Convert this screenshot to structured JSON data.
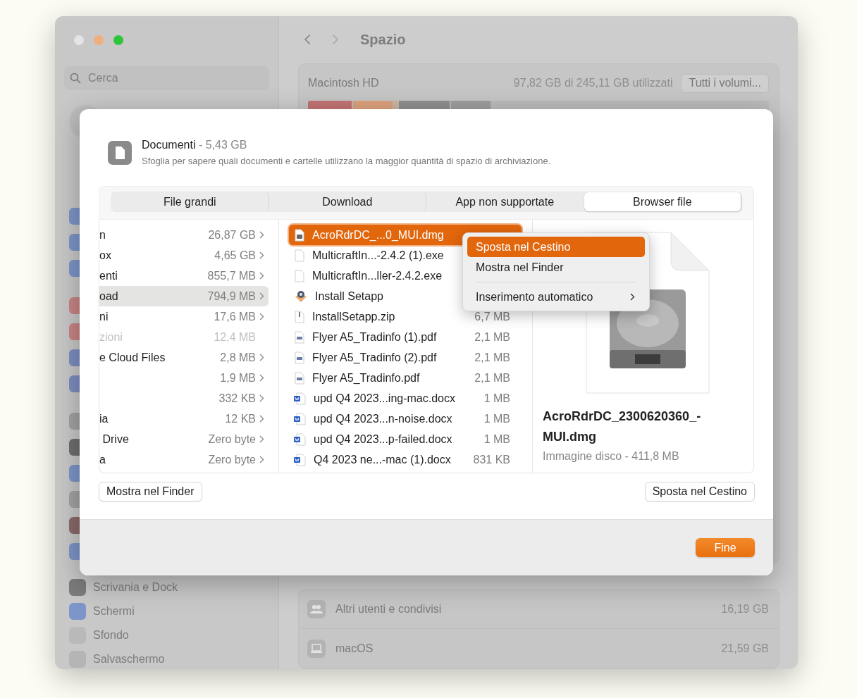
{
  "sidebar": {
    "search": {
      "placeholder": "Cerca"
    },
    "items": [
      {
        "label": "Scrivania e Dock",
        "kind": "dock"
      },
      {
        "label": "Schermi",
        "kind": "display"
      },
      {
        "label": "Sfondo",
        "kind": "wallpaper"
      },
      {
        "label": "Salvaschermo",
        "kind": "screensaver"
      }
    ]
  },
  "toolbar": {
    "title": "Spazio"
  },
  "volume": {
    "name": "Macintosh HD",
    "usage": "97,82 GB di 245,11 GB utilizzati",
    "button": "Tutti i volumi..."
  },
  "categories": [
    {
      "label": "Altri utenti e condivisi",
      "size": "16,19 GB",
      "kind": "users"
    },
    {
      "label": "macOS",
      "size": "21,59 GB",
      "kind": "laptop"
    }
  ],
  "dialog": {
    "title": "Documenti",
    "size": "- 5,43 GB",
    "description": "Sfoglia per sapere quali documenti e cartelle utilizzano la maggior quantità di spazio di archiviazione.",
    "tabs": [
      {
        "label": "File grandi",
        "selected": false
      },
      {
        "label": "Download",
        "selected": false
      },
      {
        "label": "App non supportate",
        "selected": false
      },
      {
        "label": "Browser file",
        "selected": true
      }
    ],
    "folders": [
      {
        "name": "n",
        "size": "26,87 GB",
        "selected": false,
        "disabled": false
      },
      {
        "name": "ox",
        "size": "4,65 GB",
        "selected": false,
        "disabled": false
      },
      {
        "name": "enti",
        "size": "855,7 MB",
        "selected": false,
        "disabled": false
      },
      {
        "name": "oad",
        "size": "794,9 MB",
        "selected": true,
        "disabled": false
      },
      {
        "name": "ni",
        "size": "17,6 MB",
        "selected": false,
        "disabled": false
      },
      {
        "name": "zioni",
        "size": "12,4 MB",
        "selected": false,
        "disabled": true
      },
      {
        "name": "e Cloud Files",
        "size": "2,8 MB",
        "selected": false,
        "disabled": false
      },
      {
        "size": "1,9 MB",
        "selected": false,
        "disabled": false
      },
      {
        "size": "332 KB",
        "selected": false,
        "disabled": false
      },
      {
        "name": "ia",
        "size": "12 KB",
        "selected": false,
        "disabled": false
      },
      {
        "name": " Drive",
        "size": "Zero byte",
        "selected": false,
        "disabled": false
      },
      {
        "name": "a",
        "size": "Zero byte",
        "selected": false,
        "disabled": false
      }
    ],
    "files": [
      {
        "name": "AcroRdrDC_...0_MUI.dmg",
        "kind": "dmg",
        "selected": true
      },
      {
        "name": "MulticraftIn...-2.4.2 (1).exe",
        "kind": "exe",
        "selected": false
      },
      {
        "name": "MulticraftIn...ller-2.4.2.exe",
        "kind": "exe",
        "selected": false
      },
      {
        "name": "Install Setapp",
        "kind": "app",
        "selected": false
      },
      {
        "name": "InstallSetapp.zip",
        "size": "6,7 MB",
        "kind": "zip",
        "selected": false
      },
      {
        "name": "Flyer A5_Tradinfo (1).pdf",
        "size": "2,1 MB",
        "kind": "pdf",
        "selected": false
      },
      {
        "name": "Flyer A5_Tradinfo (2).pdf",
        "size": "2,1 MB",
        "kind": "pdf",
        "selected": false
      },
      {
        "name": "Flyer A5_Tradinfo.pdf",
        "size": "2,1 MB",
        "kind": "pdf",
        "selected": false
      },
      {
        "name": "upd Q4 2023...ing-mac.docx",
        "size": "1 MB",
        "kind": "docx",
        "selected": false
      },
      {
        "name": "upd Q4 2023...n-noise.docx",
        "size": "1 MB",
        "kind": "docx",
        "selected": false
      },
      {
        "name": "upd Q4 2023...p-failed.docx",
        "size": "1 MB",
        "kind": "docx",
        "selected": false
      },
      {
        "name": "Q4 2023 ne...-mac (1).docx",
        "size": "831 KB",
        "kind": "docx",
        "selected": false
      }
    ],
    "preview": {
      "name": "AcroRdrDC_2300620360_-MUI.dmg",
      "info": "Immagine disco - 411,8 MB"
    },
    "left_button": "Mostra nel Finder",
    "right_button": "Sposta nel Cestino",
    "done_button": "Fine",
    "context_menu": [
      {
        "kind": "item",
        "label": "Sposta nel Cestino",
        "selected": true
      },
      {
        "kind": "item",
        "label": "Mostra nel Finder",
        "selected": false
      },
      {
        "kind": "separator"
      },
      {
        "kind": "submenu",
        "label": "Inserimento automatico",
        "selected": false
      }
    ]
  }
}
